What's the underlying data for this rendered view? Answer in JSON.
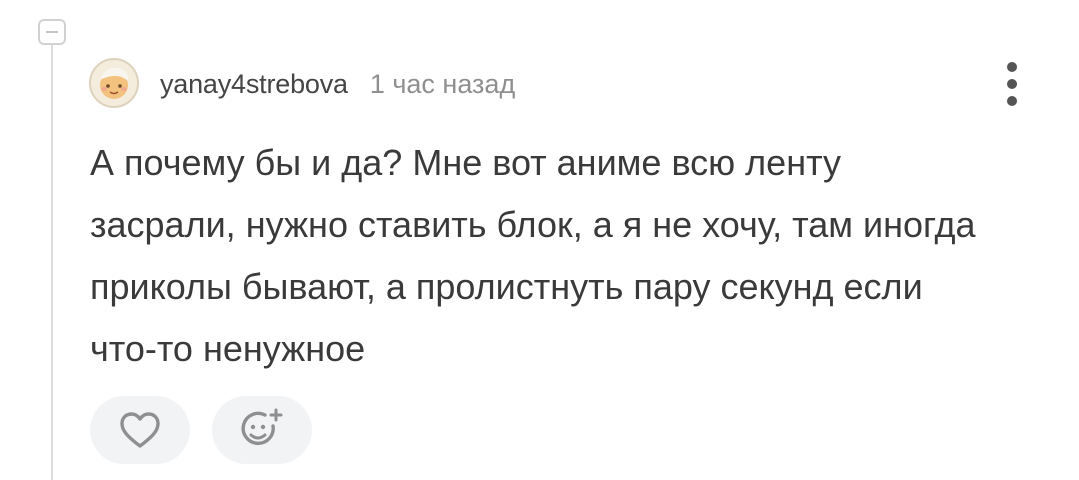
{
  "comment": {
    "author": "yanay4strebova",
    "time": "1 час назад",
    "text": "А почему бы и да? Мне вот аниме всю ленту засрали, нужно ставить блок, а я не хочу, там иногда приколы бывают, а пролистнуть пару секунд если что-то ненужное"
  },
  "icons": {
    "collapse": "minus-square-icon",
    "avatar": "user-avatar",
    "more": "vertical-ellipsis-icon",
    "like": "heart-icon",
    "react": "add-reaction-icon"
  },
  "colors": {
    "text": "#3a3a3a",
    "muted": "#8f8f8f",
    "button_bg": "#f1f3f5",
    "icon": "#8f8f8f"
  }
}
